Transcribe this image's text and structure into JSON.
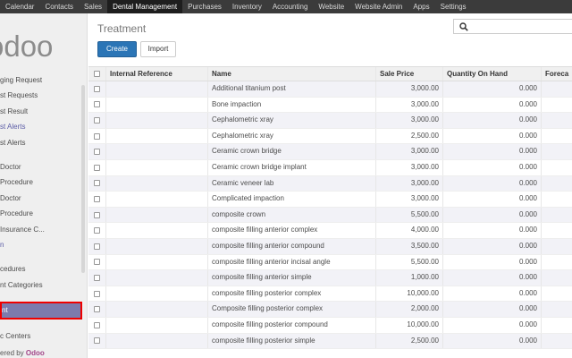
{
  "topnav": [
    "Calendar",
    "Contacts",
    "Sales",
    "Dental Management",
    "Purchases",
    "Inventory",
    "Accounting",
    "Website",
    "Website Admin",
    "Apps",
    "Settings"
  ],
  "logo_text": "odoo",
  "sidebar": {
    "items": [
      {
        "label": "ging Request",
        "kind": "normal"
      },
      {
        "label": "st Requests",
        "kind": "normal"
      },
      {
        "label": "st Result",
        "kind": "normal"
      },
      {
        "label": "st Alerts",
        "kind": "head"
      },
      {
        "label": "st Alerts",
        "kind": "normal"
      },
      {
        "label": "",
        "kind": "gap"
      },
      {
        "label": "Doctor",
        "kind": "normal"
      },
      {
        "label": "Procedure",
        "kind": "normal"
      },
      {
        "label": "Doctor",
        "kind": "normal"
      },
      {
        "label": "Procedure",
        "kind": "normal"
      },
      {
        "label": "Insurance C...",
        "kind": "normal"
      },
      {
        "label": "n",
        "kind": "head"
      },
      {
        "label": "",
        "kind": "gap"
      },
      {
        "label": "cedures",
        "kind": "normal"
      },
      {
        "label": "nt Categories",
        "kind": "normal"
      },
      {
        "label": "",
        "kind": "gap"
      },
      {
        "label": "nt",
        "kind": "active"
      },
      {
        "label": "",
        "kind": "gap"
      },
      {
        "label": "c Centers",
        "kind": "normal"
      }
    ],
    "powered_prefix": "ered by ",
    "powered_brand": "Odoo"
  },
  "page": {
    "title": "Treatment",
    "create_label": "Create",
    "import_label": "Import",
    "search_icon": "search-icon"
  },
  "table": {
    "headers": {
      "ref": "Internal Reference",
      "name": "Name",
      "price": "Sale Price",
      "qty": "Quantity On Hand",
      "forecast": "Foreca"
    },
    "rows": [
      {
        "name": "Additional titanium post",
        "price": "3,000.00",
        "qty": "0.000"
      },
      {
        "name": "Bone impaction",
        "price": "3,000.00",
        "qty": "0.000"
      },
      {
        "name": "Cephalometric xray",
        "price": "3,000.00",
        "qty": "0.000"
      },
      {
        "name": "Cephalometric xray",
        "price": "2,500.00",
        "qty": "0.000"
      },
      {
        "name": "Ceramic crown bridge",
        "price": "3,000.00",
        "qty": "0.000"
      },
      {
        "name": "Ceramic crown bridge implant",
        "price": "3,000.00",
        "qty": "0.000"
      },
      {
        "name": "Ceramic veneer lab",
        "price": "3,000.00",
        "qty": "0.000"
      },
      {
        "name": "Complicated impaction",
        "price": "3,000.00",
        "qty": "0.000"
      },
      {
        "name": "composite crown",
        "price": "5,500.00",
        "qty": "0.000"
      },
      {
        "name": "composite filling anterior complex",
        "price": "4,000.00",
        "qty": "0.000"
      },
      {
        "name": "composite filling anterior compound",
        "price": "3,500.00",
        "qty": "0.000"
      },
      {
        "name": "composite filling anterior incisal angle",
        "price": "5,500.00",
        "qty": "0.000"
      },
      {
        "name": "composite filling anterior simple",
        "price": "1,000.00",
        "qty": "0.000"
      },
      {
        "name": "composite filling posterior complex",
        "price": "10,000.00",
        "qty": "0.000"
      },
      {
        "name": "Composite filling posterior complex",
        "price": "2,000.00",
        "qty": "0.000"
      },
      {
        "name": "composite filling posterior compound",
        "price": "10,000.00",
        "qty": "0.000"
      },
      {
        "name": "composite filling posterior simple",
        "price": "2,500.00",
        "qty": "0.000"
      }
    ]
  }
}
